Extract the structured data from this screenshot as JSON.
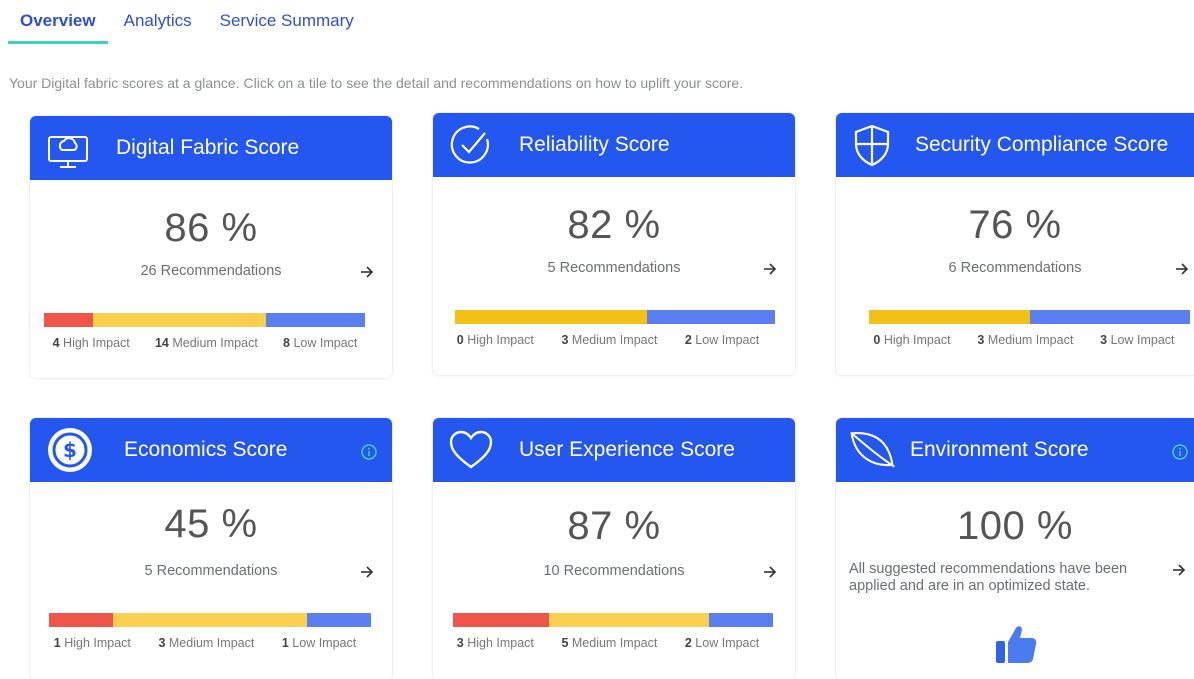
{
  "tabs": [
    {
      "label": "Overview",
      "active": true
    },
    {
      "label": "Analytics",
      "active": false
    },
    {
      "label": "Service Summary",
      "active": false
    }
  ],
  "intro": "Your Digital fabric scores at a glance. Click on a tile to see the detail and recommendations on how to uplift your score.",
  "colors": {
    "header": "#2456f0",
    "high": "#f0554a",
    "medium_bright": "#fcd04f",
    "medium_dark": "#f3c116",
    "low": "#5b7ff0",
    "accent_tab": "#3fd0c0"
  },
  "cards": [
    {
      "title": "Digital Fabric Score",
      "icon": "cloud-monitor-icon",
      "percent": "86 %",
      "score_value": 86,
      "recommendations": "26 Recommendations",
      "impact": {
        "high": 4,
        "medium": 14,
        "low": 8
      },
      "labels": {
        "high": "High Impact",
        "medium": "Medium Impact",
        "low": "Low Impact"
      }
    },
    {
      "title": "Reliability Score",
      "icon": "check-circle-icon",
      "percent": "82 %",
      "score_value": 82,
      "recommendations": "5 Recommendations",
      "impact": {
        "high": 0,
        "medium": 3,
        "low": 2
      },
      "labels": {
        "high": "High Impact",
        "medium": "Medium Impact",
        "low": "Low Impact"
      }
    },
    {
      "title": "Security Compliance Score",
      "icon": "shield-icon",
      "percent": "76 %",
      "score_value": 76,
      "recommendations": "6 Recommendations",
      "impact": {
        "high": 0,
        "medium": 3,
        "low": 3
      },
      "labels": {
        "high": "High Impact",
        "medium": "Medium Impact",
        "low": "Low Impact"
      }
    },
    {
      "title": "Economics Score",
      "icon": "dollar-circle-icon",
      "info_icon": "info-icon",
      "percent": "45 %",
      "score_value": 45,
      "recommendations": "5 Recommendations",
      "impact": {
        "high": 1,
        "medium": 3,
        "low": 1
      },
      "labels": {
        "high": "High Impact",
        "medium": "Medium Impact",
        "low": "Low Impact"
      }
    },
    {
      "title": "User Experience Score",
      "icon": "heart-icon",
      "percent": "87 %",
      "score_value": 87,
      "recommendations": "10 Recommendations",
      "impact": {
        "high": 3,
        "medium": 5,
        "low": 2
      },
      "labels": {
        "high": "High Impact",
        "medium": "Medium Impact",
        "low": "Low Impact"
      }
    },
    {
      "title": "Environment Score",
      "icon": "leaf-icon",
      "info_icon": "info-icon",
      "percent": "100 %",
      "score_value": 100,
      "message": "All suggested recommendations have been applied and are in an optimized state.",
      "status_icon": "thumbs-up-icon"
    }
  ]
}
